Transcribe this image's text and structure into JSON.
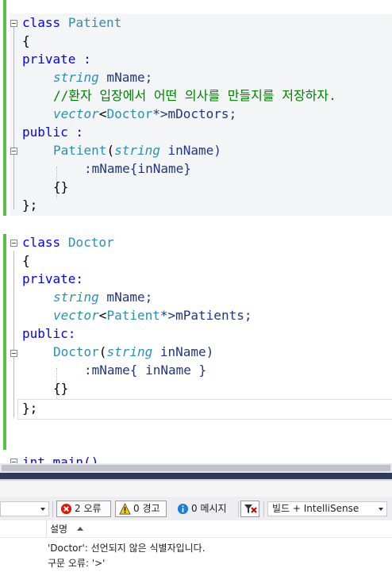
{
  "editor": {
    "patient_class": {
      "decl_kw": "class",
      "decl_name": "Patient",
      "open_brace": "{",
      "private_label": "private :",
      "member1_type": "string",
      "member1_name": " mName;",
      "comment": "//환자 입장에서 어떤 의사를 만들지를 저장하자.",
      "member2_type": "vector",
      "member2_lt": "<",
      "member2_arg": "Doctor",
      "member2_rest": "*>mDoctors;",
      "public_label": "public :",
      "ctor_name": "Patient",
      "ctor_paren": "(",
      "ctor_param_type": "string",
      "ctor_param_rest": " inName)",
      "init_list": ":mName{inName}",
      "ctor_body": "{}",
      "close": "};"
    },
    "doctor_class": {
      "decl_kw": "class",
      "decl_name": "Doctor",
      "open_brace": "{",
      "private_label": "private:",
      "member1_type": "string",
      "member1_name": " mName;",
      "member2_type": "vector",
      "member2_lt": "<",
      "member2_arg": "Patient",
      "member2_rest": "*>mPatients;",
      "public_label": "public:",
      "ctor_name": "Doctor",
      "ctor_paren": "(",
      "ctor_param_type": "string",
      "ctor_param_rest": " inName)",
      "init_list": ":mName{ inName }",
      "ctor_body": "{}",
      "close": "};"
    },
    "main_partial": "int main()"
  },
  "error_list": {
    "errors_label": "2 오류",
    "warnings_label": "0 경고",
    "messages_label": "0 메시지",
    "build_filter": "빌드 + IntelliSense",
    "column_description": "설명",
    "rows": [
      "'Doctor': 선언되지 않은 식별자입니다.",
      "구문 오류: '>'"
    ]
  },
  "colors": {
    "keyword": "#0000ff",
    "type": "#2b91af",
    "parameter": "#1f377f",
    "comment": "#008000",
    "change_bar": "#57c04a",
    "error_icon": "#e51400",
    "warning_icon": "#f7cd00",
    "info_icon": "#1a80d9"
  },
  "icons": {
    "fold": "collapse-box-icon",
    "error": "error-circle-icon",
    "warning": "warning-triangle-icon",
    "info": "info-circle-icon",
    "filter": "filter-icon"
  }
}
